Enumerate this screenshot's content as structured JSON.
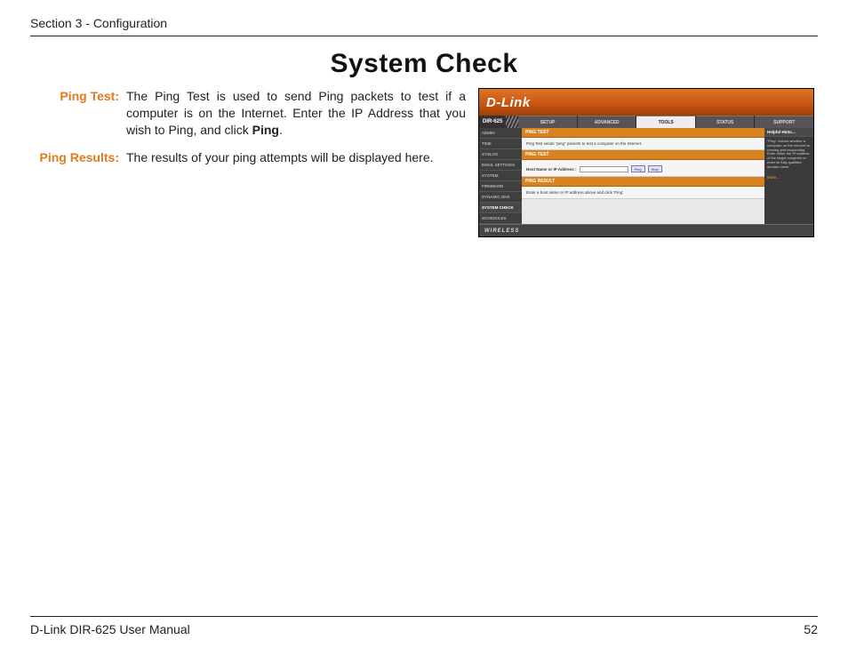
{
  "header": {
    "section": "Section 3 - Configuration"
  },
  "title": "System Check",
  "doc": {
    "items": [
      {
        "label": "Ping Test:",
        "text_pre": "The Ping Test is used to send Ping packets to test if a computer is on the Internet. Enter the IP Address that you wish to Ping, and click ",
        "bold": "Ping",
        "text_post": "."
      },
      {
        "label": "Ping Results:",
        "text_pre": "The results of your ping attempts will be displayed here.",
        "bold": "",
        "text_post": ""
      }
    ]
  },
  "ui": {
    "brand": "D-Link",
    "model": "DIR-625",
    "top_tabs": [
      "SETUP",
      "ADVANCED",
      "TOOLS",
      "STATUS",
      "SUPPORT"
    ],
    "active_top_tab": 2,
    "side": [
      "ADMIN",
      "TIME",
      "SYSLOG",
      "EMAIL SETTINGS",
      "SYSTEM",
      "FIRMWARE",
      "DYNAMIC DNS",
      "SYSTEM CHECK",
      "SCHEDULES"
    ],
    "active_side": 7,
    "sections": {
      "pingtest_title": "PING TEST",
      "pingtest_desc": "Ping Test sends \"ping\" packets to test a computer on the Internet.",
      "pingtest_field": "Host Name or IP Address :",
      "ping_btn": "Ping",
      "stop_btn": "Stop",
      "pingresult_title": "PING RESULT",
      "pingresult_desc": "Enter a host name or IP address above and click 'Ping'"
    },
    "hints": {
      "title": "Helpful Hints…",
      "body": "\"Ping\" checks whether a computer on the Internet is running and responding. Enter either the IP address of the target computer or enter its fully qualified domain name.",
      "more": "More…"
    },
    "wireless": "WIRELESS"
  },
  "footer": {
    "left": "D-Link DIR-625 User Manual",
    "page": "52"
  }
}
